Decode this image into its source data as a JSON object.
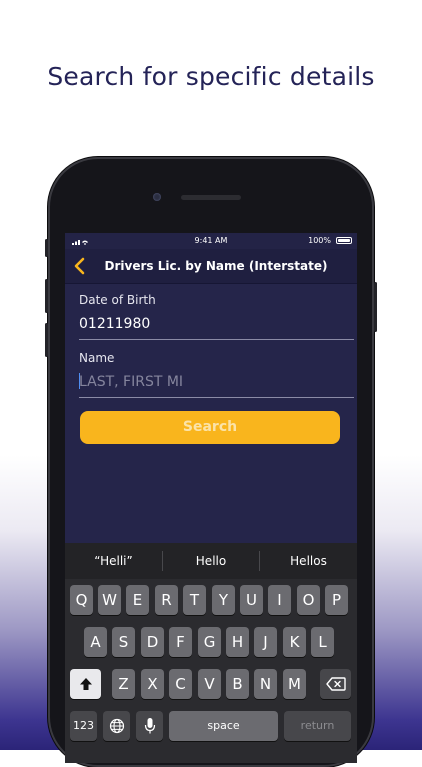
{
  "headline": "Search for specific details",
  "status_bar": {
    "time": "9:41 AM",
    "battery": "100%"
  },
  "nav": {
    "back_icon": "chevron-left-icon",
    "title": "Drivers Lic. by Name (Interstate)"
  },
  "form": {
    "dob_label": "Date of Birth",
    "dob_value": "01211980",
    "name_label": "Name",
    "name_placeholder": "LAST, FIRST MI",
    "name_value": ""
  },
  "search_button": {
    "label": "Search",
    "color": "#f9b51d"
  },
  "keyboard": {
    "suggestions": [
      "“Helli”",
      "Hello",
      "Hellos"
    ],
    "row1": [
      "Q",
      "W",
      "E",
      "R",
      "T",
      "Y",
      "U",
      "I",
      "O",
      "P"
    ],
    "row2": [
      "A",
      "S",
      "D",
      "F",
      "G",
      "H",
      "J",
      "K",
      "L"
    ],
    "row3": [
      "Z",
      "X",
      "C",
      "V",
      "B",
      "N",
      "M"
    ],
    "numbers_label": "123",
    "space_label": "space",
    "return_label": "return",
    "shift_icon": "shift-icon",
    "backspace_icon": "backspace-icon",
    "globe_icon": "globe-icon",
    "mic_icon": "microphone-icon"
  },
  "colors": {
    "screen_bg": "#25254a",
    "accent": "#f9b51d"
  }
}
